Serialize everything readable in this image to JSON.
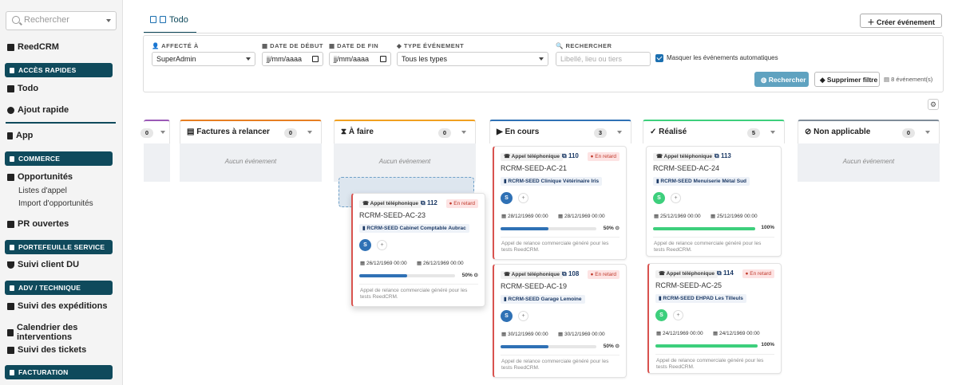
{
  "sidebar": {
    "search_placeholder": "Rechercher",
    "items": {
      "home": "ReedCRM",
      "todo": "Todo",
      "ajout": "Ajout rapide",
      "app": "App",
      "opportunites": "Opportunités",
      "listes": "Listes d'appel",
      "import": "Import d'opportunités",
      "pr": "PR ouvertes",
      "suivi_client": "Suivi client DU",
      "expeditions": "Suivi des expéditions",
      "calendrier": "Calendrier des interventions",
      "tickets": "Suivi des tickets"
    },
    "sections": {
      "acces": "ACCÈS RAPIDES",
      "commerce": "COMMERCE",
      "portefeuille": "PORTEFEUILLE SERVICE",
      "adv": "ADV / TECHNIQUE",
      "facturation": "FACTURATION"
    }
  },
  "header": {
    "tab_label": "Todo",
    "create_label": "Créer événement"
  },
  "filters": {
    "affecte_label": "AFFECTÉ À",
    "affecte_value": "SuperAdmin",
    "debut_label": "DATE DE DÉBUT",
    "debut_value": "jj/mm/aaaa",
    "fin_label": "DATE DE FIN",
    "fin_value": "jj/mm/aaaa",
    "type_label": "TYPE ÉVÉNEMENT",
    "type_value": "Tous les types",
    "search_label": "RECHERCHER",
    "search_placeholder": "Libellé, lieu ou tiers",
    "auto_label": "Masquer les événements automatiques",
    "search_btn": "Rechercher",
    "clear_btn": "Supprimer filtre",
    "count": "8 événement(s)"
  },
  "columns": {
    "c0": {
      "count": "0"
    },
    "factures": {
      "label": "Factures à relancer",
      "count": "0",
      "empty": "Aucun événement"
    },
    "afaire": {
      "label": "À faire",
      "count": "0",
      "empty": "Aucun événement"
    },
    "encours": {
      "label": "En cours",
      "count": "3"
    },
    "realise": {
      "label": "Réalisé",
      "count": "5"
    },
    "na": {
      "label": "Non applicable",
      "count": "0",
      "empty": "Aucun événement"
    }
  },
  "cards": {
    "drag": {
      "type": "Appel téléphonique",
      "num": "112",
      "late": "En retard",
      "code": "RCRM-SEED-AC-23",
      "company": "RCRM-SEED Cabinet Comptable Aubrac",
      "avatar": "S",
      "d1": "26/12/1969 00:00",
      "d2": "26/12/1969 00:00",
      "pct": "50%",
      "progress": 0.5,
      "desc1": "Appel de relance commerciale généré pour les",
      "desc2": "tests ReedCRM."
    },
    "e1": {
      "type": "Appel téléphonique",
      "num": "110",
      "late": "En retard",
      "code": "RCRM-SEED-AC-21",
      "company": "RCRM-SEED Clinique Vétérinaire Iris",
      "avatar": "S",
      "d1": "28/12/1969 00:00",
      "d2": "28/12/1969 00:00",
      "pct": "50%",
      "progress": 0.5,
      "desc1": "Appel de relance commerciale généré pour les",
      "desc2": "tests ReedCRM."
    },
    "e2": {
      "type": "Appel téléphonique",
      "num": "108",
      "late": "En retard",
      "code": "RCRM-SEED-AC-19",
      "company": "RCRM-SEED Garage Lemoine",
      "avatar": "S",
      "d1": "30/12/1969 00:00",
      "d2": "30/12/1969 00:00",
      "pct": "50%",
      "progress": 0.5,
      "desc1": "Appel de relance commerciale généré pour les",
      "desc2": "tests ReedCRM."
    },
    "r1": {
      "type": "Appel téléphonique",
      "num": "113",
      "code": "RCRM-SEED-AC-24",
      "company": "RCRM-SEED Menuiserie Métal Sud",
      "avatar": "S",
      "d1": "25/12/1969 00:00",
      "d2": "25/12/1969 00:00",
      "pct": "100%",
      "progress": 1.0,
      "desc1": "Appel de relance commerciale généré pour les",
      "desc2": "tests ReedCRM."
    },
    "r2": {
      "type": "Appel téléphonique",
      "num": "114",
      "late": "En retard",
      "code": "RCRM-SEED-AC-25",
      "company": "RCRM-SEED EHPAD Les Tilleuls",
      "avatar": "S",
      "d1": "24/12/1969 00:00",
      "d2": "24/12/1969 00:00",
      "pct": "100%",
      "progress": 1.0,
      "desc1": "Appel de relance commerciale généré pour les",
      "desc2": "tests ReedCRM."
    }
  },
  "colors": {
    "primary": "#0f4a5c",
    "late": "#d9534f",
    "progress_blue": "#2f71b5",
    "progress_green": "#3dcf7c"
  }
}
